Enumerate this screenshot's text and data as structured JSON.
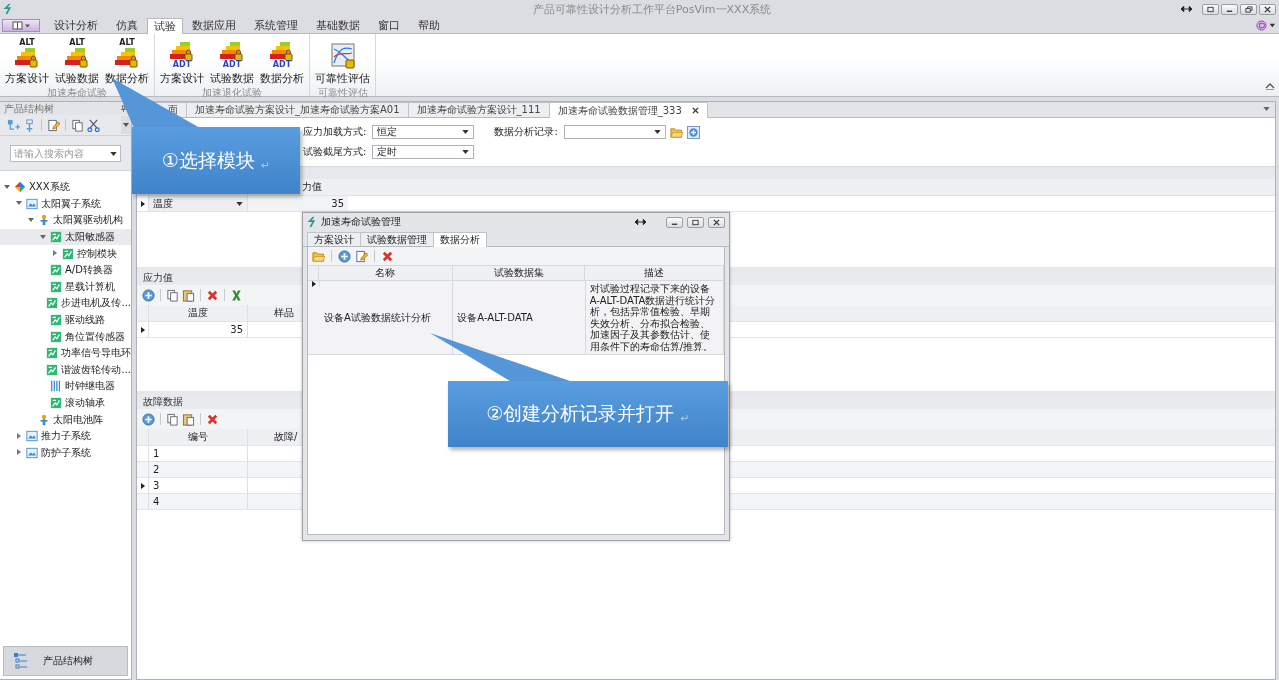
{
  "window": {
    "title": "产品可靠性设计分析工作平台PosVim一XXX系统"
  },
  "menu_tabs": [
    {
      "label": "设计分析",
      "selected": false
    },
    {
      "label": "仿真",
      "selected": false
    },
    {
      "label": "试验",
      "selected": true
    },
    {
      "label": "数据应用",
      "selected": false
    },
    {
      "label": "系统管理",
      "selected": false
    },
    {
      "label": "基础数据",
      "selected": false
    },
    {
      "label": "窗口",
      "selected": false
    },
    {
      "label": "帮助",
      "selected": false
    }
  ],
  "ribbon": {
    "groups": [
      {
        "label": "加速寿命试验",
        "buttons": [
          {
            "kind": "bars",
            "badge": "ALT",
            "label": "方案设计"
          },
          {
            "kind": "bars",
            "badge": "ALT",
            "label": "试验数据"
          },
          {
            "kind": "bars",
            "badge": "ALT",
            "label": "数据分析"
          }
        ]
      },
      {
        "label": "加速退化试验",
        "buttons": [
          {
            "kind": "bars",
            "badge": "ADT",
            "label": "方案设计"
          },
          {
            "kind": "bars",
            "badge": "ADT",
            "label": "试验数据"
          },
          {
            "kind": "bars",
            "badge": "ADT",
            "label": "数据分析"
          }
        ]
      },
      {
        "label": "可靠性评估",
        "buttons": [
          {
            "kind": "curve",
            "label": "可靠性评估"
          }
        ]
      }
    ]
  },
  "sidebar": {
    "title": "产品结构树",
    "search": {
      "placeholder": "请输入搜索内容"
    },
    "tree": [
      {
        "label": "XXX系统",
        "kind": "system",
        "expanded": true,
        "selected": false,
        "children": [
          {
            "label": "太阳翼子系统",
            "kind": "subsystem",
            "expanded": true,
            "selected": false,
            "children": [
              {
                "label": "太阳翼驱动机构",
                "kind": "assembly",
                "expanded": true,
                "selected": false,
                "children": [
                  {
                    "label": "太阳敏感器",
                    "kind": "part",
                    "expanded": true,
                    "selected": true,
                    "children": [
                      {
                        "label": "控制模块",
                        "kind": "part",
                        "expanded": false,
                        "selected": false
                      }
                    ]
                  },
                  {
                    "label": "A/D转换器",
                    "kind": "part",
                    "selected": false
                  },
                  {
                    "label": "星载计算机",
                    "kind": "part",
                    "selected": false
                  },
                  {
                    "label": "步进电机及传...",
                    "kind": "part",
                    "selected": false
                  },
                  {
                    "label": "驱动线路",
                    "kind": "part",
                    "selected": false
                  },
                  {
                    "label": "角位置传感器",
                    "kind": "part",
                    "selected": false
                  },
                  {
                    "label": "功率信号导电环",
                    "kind": "part",
                    "selected": false
                  },
                  {
                    "label": "谐波齿轮传动...",
                    "kind": "part",
                    "selected": false
                  },
                  {
                    "label": "时钟继电器",
                    "kind": "relay",
                    "selected": false
                  },
                  {
                    "label": "滚动轴承",
                    "kind": "part",
                    "selected": false
                  }
                ]
              },
              {
                "label": "太阳电池阵",
                "kind": "assembly",
                "selected": false
              }
            ]
          },
          {
            "label": "推力子系统",
            "kind": "subsystem",
            "expanded": false,
            "selected": false
          },
          {
            "label": "防护子系统",
            "kind": "subsystem",
            "expanded": false,
            "selected": false
          }
        ]
      }
    ],
    "footer_button": "产品结构树"
  },
  "doc_tabs": [
    {
      "label": "面",
      "selected": false
    },
    {
      "label": "加速寿命试验方案设计_加速寿命试验方案A01",
      "selected": false
    },
    {
      "label": "加速寿命试验方案设计_111",
      "selected": false
    },
    {
      "label": "加速寿命试验数据管理_333",
      "selected": true
    }
  ],
  "form": {
    "loading_mode": {
      "label": "应力加载方式:",
      "value": "恒定"
    },
    "analysis_record": {
      "label": "数据分析记录:"
    },
    "censoring_mode": {
      "label": "试验截尾方式:",
      "value": "定时"
    }
  },
  "stress_table": {
    "column": "力值",
    "rows": [
      {
        "factor": "温度",
        "value": "35",
        "selected": true
      }
    ]
  },
  "stress_values": {
    "title": "应力值",
    "columns": [
      "温度",
      "样品"
    ],
    "rows": [
      {
        "cells": [
          "35"
        ],
        "selected": true
      }
    ]
  },
  "fault_data": {
    "title": "故障数据",
    "columns": [
      "编号",
      "故障/"
    ],
    "rows": [
      {
        "cells": [
          "1"
        ],
        "selected": false
      },
      {
        "cells": [
          "2"
        ],
        "selected": false
      },
      {
        "cells": [
          "3"
        ],
        "selected": true
      },
      {
        "cells": [
          "4"
        ],
        "selected": false
      }
    ]
  },
  "dialog": {
    "title": "加速寿命试验管理",
    "tabs": [
      {
        "label": "方案设计",
        "selected": false
      },
      {
        "label": "试验数据管理",
        "selected": false
      },
      {
        "label": "数据分析",
        "selected": true
      }
    ],
    "table": {
      "columns": [
        "名称",
        "试验数据集",
        "描述"
      ],
      "rows": [
        {
          "cells": [
            "设备A试验数据统计分析",
            "设备A-ALT-DATA",
            "对试验过程记录下来的设备A-ALT-DATA数据进行统计分析，包括异常值检验、早期失效分析、分布拟合检验、加速因子及其参数估计、使用条件下的寿命估算/推算。"
          ],
          "selected": true
        }
      ]
    }
  },
  "callouts": [
    {
      "text": "①选择模块",
      "mark": "↵"
    },
    {
      "text": "②创建分析记录并打开",
      "mark": "↵"
    }
  ]
}
